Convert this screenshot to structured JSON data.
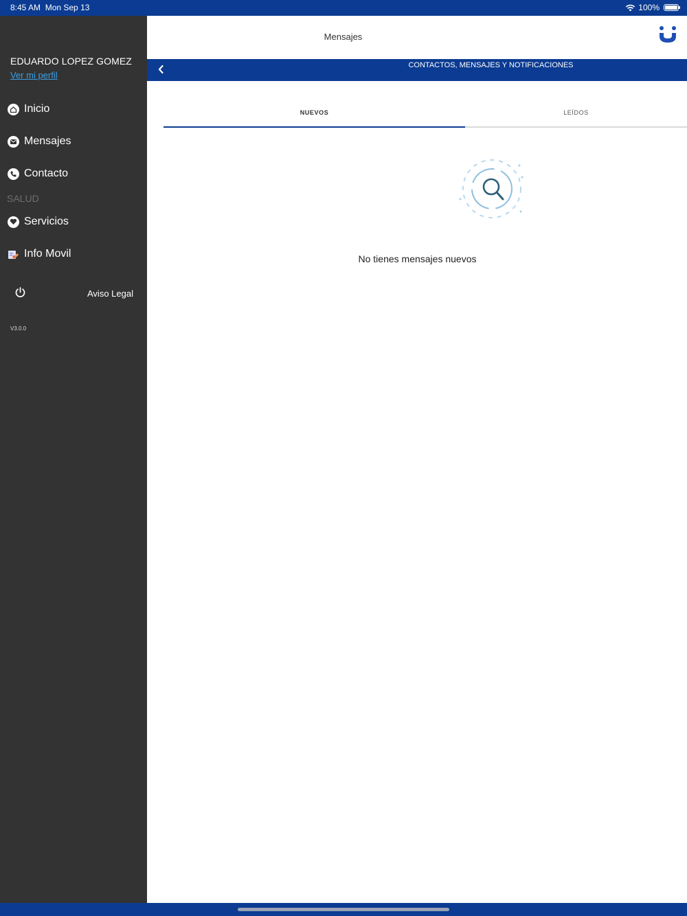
{
  "status_bar": {
    "time": "8:45 AM",
    "date": "Mon Sep 13",
    "battery": "100%"
  },
  "sidebar": {
    "user_name": "EDUARDO LOPEZ GOMEZ",
    "profile_link": "Ver mi perfil",
    "items": [
      {
        "label": "Inicio",
        "icon": "home-icon"
      },
      {
        "label": "Mensajes",
        "icon": "mail-icon"
      },
      {
        "label": "Contacto",
        "icon": "phone-icon"
      }
    ],
    "section_label": "SALUD",
    "section_items": [
      {
        "label": "Servicios",
        "icon": "heart-icon"
      },
      {
        "label": "Info Movil",
        "icon": "info-card-icon"
      }
    ],
    "legal": "Aviso Legal",
    "version": "V3.0.0"
  },
  "header": {
    "title": "Mensajes"
  },
  "subheader": {
    "title": "CONTACTOS, MENSAJES Y NOTIFICACIONES"
  },
  "tabs": [
    {
      "label": "NUEVOS",
      "active": true
    },
    {
      "label": "LEÍDOS",
      "active": false
    }
  ],
  "empty_state": {
    "message": "No tienes mensajes nuevos",
    "icon": "search-empty-icon"
  },
  "colors": {
    "brand": "#0b3b92",
    "sidebar": "#333333",
    "link": "#3aa0e6"
  }
}
